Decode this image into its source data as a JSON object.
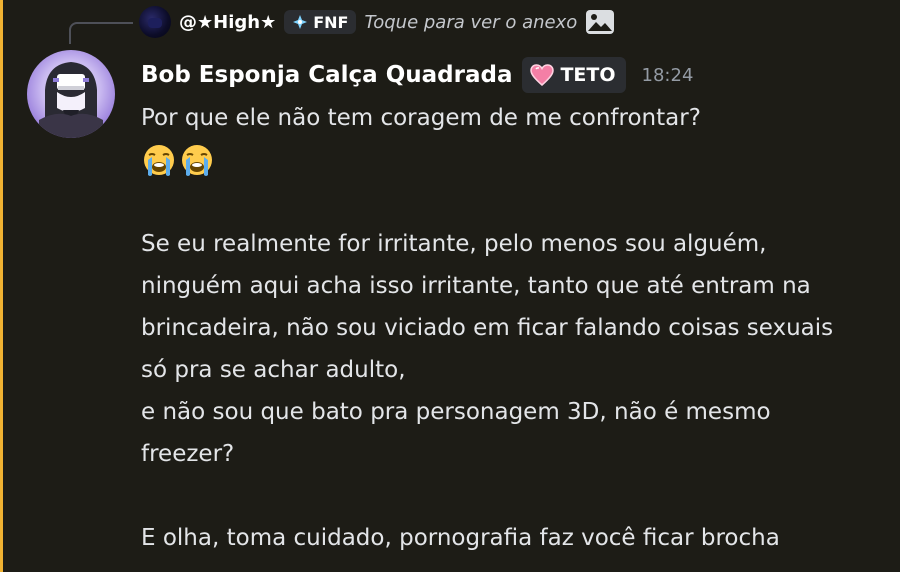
{
  "reply": {
    "author": "@★High★",
    "guild_tag": "FNF",
    "preview": "Toque para ver o anexo",
    "attachment_icon": "image-icon",
    "avatar_icon": "dark-blue-avatar"
  },
  "message": {
    "author": "Bob Esponja Calça Quadrada",
    "role_tag": "TETO",
    "role_icon": "pink-heart-icon",
    "timestamp": "18:24",
    "avatar_icon": "purple-anime-avatar",
    "emojis": [
      "loudly-crying-face",
      "loudly-crying-face"
    ],
    "lines": {
      "l1": "Por que ele não tem coragem de me confrontar?",
      "l2": "Se eu realmente for irritante, pelo menos sou alguém,",
      "l3": "ninguém aqui acha isso irritante, tanto que até entram na",
      "l4": "brincadeira, não sou viciado em ficar falando coisas sexuais",
      "l5": "só pra se achar adulto,",
      "l6": "e não sou que bato pra personagem 3D, não é mesmo",
      "l7": "freezer?",
      "l8": "E olha, toma cuidado, pornografia faz você ficar brocha"
    }
  },
  "colors": {
    "background": "#1d1c16",
    "accent_bar": "#f0b232",
    "text": "#e3e5e8",
    "muted": "#949ba4",
    "tag_bg": "#2b2d31"
  }
}
